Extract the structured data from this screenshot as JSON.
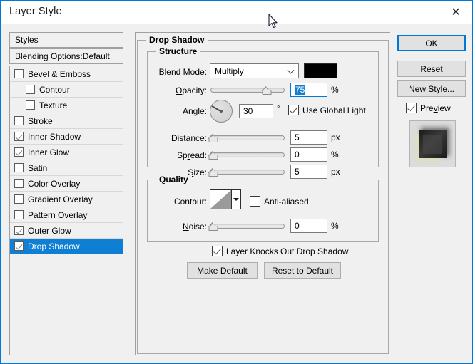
{
  "window": {
    "title": "Layer Style",
    "close_icon": "close-icon",
    "border_color": "#0078d7"
  },
  "sidebar": {
    "styles_label": "Styles",
    "blending_options_label": "Blending Options:Default",
    "effects": [
      {
        "label": "Bevel & Emboss",
        "checked": false,
        "indent": false,
        "selected": false
      },
      {
        "label": "Contour",
        "checked": false,
        "indent": true,
        "selected": false
      },
      {
        "label": "Texture",
        "checked": false,
        "indent": true,
        "selected": false
      },
      {
        "label": "Stroke",
        "checked": false,
        "indent": false,
        "selected": false
      },
      {
        "label": "Inner Shadow",
        "checked": true,
        "indent": false,
        "selected": false
      },
      {
        "label": "Inner Glow",
        "checked": true,
        "indent": false,
        "selected": false
      },
      {
        "label": "Satin",
        "checked": false,
        "indent": false,
        "selected": false
      },
      {
        "label": "Color Overlay",
        "checked": false,
        "indent": false,
        "selected": false
      },
      {
        "label": "Gradient Overlay",
        "checked": false,
        "indent": false,
        "selected": false
      },
      {
        "label": "Pattern Overlay",
        "checked": false,
        "indent": false,
        "selected": false
      },
      {
        "label": "Outer Glow",
        "checked": true,
        "indent": false,
        "selected": false
      },
      {
        "label": "Drop Shadow",
        "checked": true,
        "indent": false,
        "selected": true
      }
    ],
    "selection_color": "#0f7fd4"
  },
  "main": {
    "group_title": "Drop Shadow",
    "structure": {
      "title": "Structure",
      "blend_mode_label": "Blend Mode:",
      "blend_mode_value": "Multiply",
      "blend_mode_color": "#000000",
      "opacity_label": "Opacity:",
      "opacity_value": "75",
      "opacity_unit": "%",
      "opacity_percent": 75,
      "angle_label": "Angle:",
      "angle_value": "30",
      "angle_unit": "°",
      "use_global_light_label": "Use Global Light",
      "use_global_light_checked": true,
      "distance_label": "Distance:",
      "distance_value": "5",
      "distance_unit": "px",
      "distance_percent": 2,
      "spread_label": "Spread:",
      "spread_value": "0",
      "spread_unit": "%",
      "spread_percent": 0,
      "size_label": "Size:",
      "size_value": "5",
      "size_unit": "px",
      "size_percent": 2
    },
    "quality": {
      "title": "Quality",
      "contour_label": "Contour:",
      "anti_aliased_label": "Anti-aliased",
      "anti_aliased_checked": false,
      "noise_label": "Noise:",
      "noise_value": "0",
      "noise_unit": "%",
      "noise_percent": 0
    },
    "layer_knocks_out_label": "Layer Knocks Out Drop Shadow",
    "layer_knocks_out_checked": true,
    "make_default_label": "Make Default",
    "reset_to_default_label": "Reset to Default"
  },
  "right_panel": {
    "ok_label": "OK",
    "reset_label": "Reset",
    "new_style_label": "New Style...",
    "preview_label": "Preview",
    "preview_checked": true
  }
}
